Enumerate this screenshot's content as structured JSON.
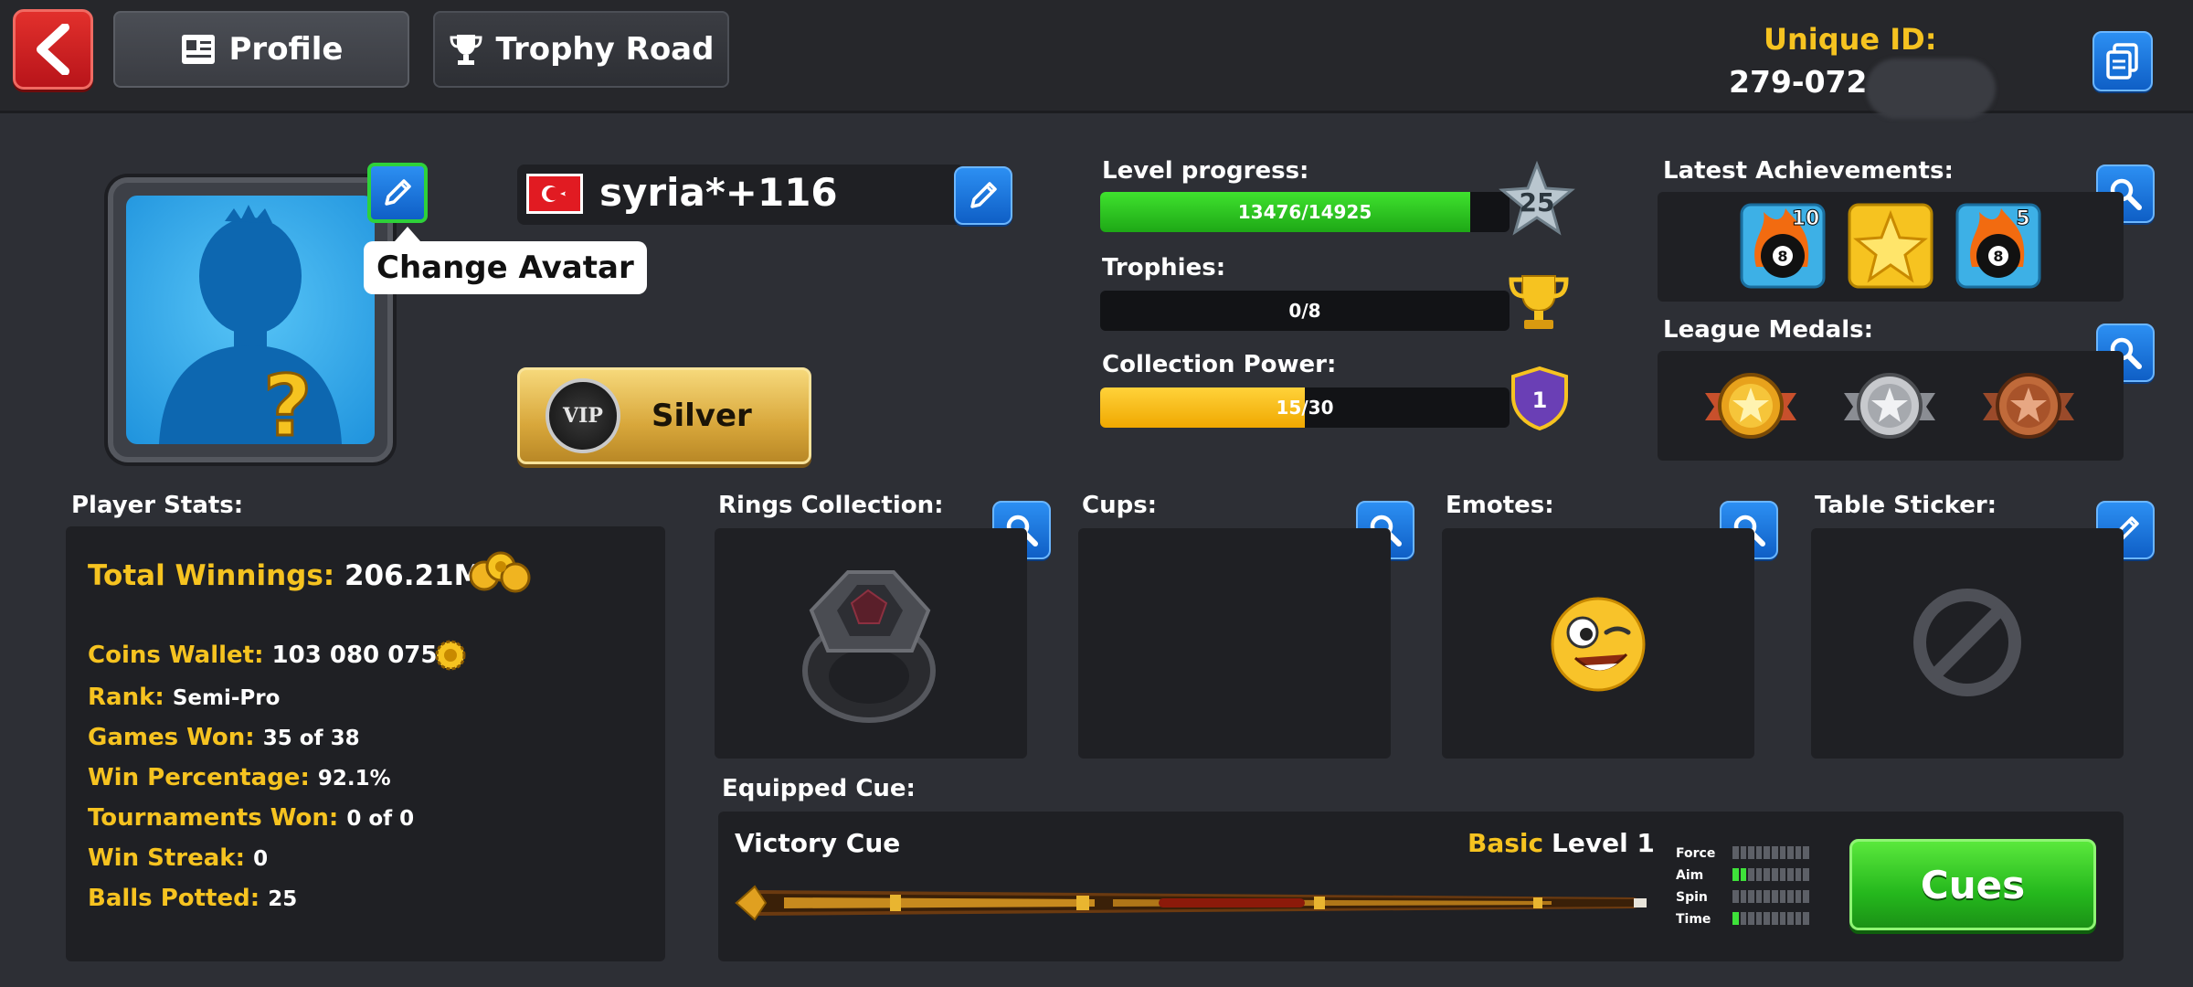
{
  "header": {
    "profile_tab": "Profile",
    "trophy_road_tab": "Trophy Road",
    "unique_id_label": "Unique ID:",
    "unique_id_value": "279-072"
  },
  "avatar": {
    "tooltip": "Change Avatar"
  },
  "player": {
    "name": "syria*+116",
    "vip_tier": "Silver",
    "vip_badge": "VIP"
  },
  "progress": {
    "level_label": "Level progress:",
    "level_text": "13476/14925",
    "level_fraction": 0.903,
    "level_number": "25",
    "trophies_label": "Trophies:",
    "trophies_text": "0/8",
    "trophies_fraction": 0.0,
    "collection_label": "Collection Power:",
    "collection_text": "15/30",
    "collection_fraction": 0.5,
    "collection_badge": "1"
  },
  "achievements": {
    "label": "Latest Achievements:",
    "items": [
      {
        "icon": "eight-ball-fire-icon",
        "count": "10"
      },
      {
        "icon": "gold-star-icon",
        "count": ""
      },
      {
        "icon": "eight-ball-fire-icon",
        "count": "5"
      }
    ]
  },
  "league_medals": {
    "label": "League Medals:",
    "items": [
      "gold-medal-icon",
      "silver-medal-icon",
      "bronze-medal-icon"
    ]
  },
  "stats": {
    "title": "Player Stats:",
    "total_winnings_label": "Total Winnings:",
    "total_winnings_value": "206.21M",
    "coins_wallet_label": "Coins Wallet:",
    "coins_wallet_value": "103 080 075",
    "rank_label": "Rank:",
    "rank_value": "Semi-Pro",
    "games_won_label": "Games Won:",
    "games_won_value": "35 of 38",
    "win_percentage_label": "Win Percentage:",
    "win_percentage_value": "92.1%",
    "tournaments_won_label": "Tournaments Won:",
    "tournaments_won_value": "0 of 0",
    "win_streak_label": "Win Streak:",
    "win_streak_value": "0",
    "balls_potted_label": "Balls Potted:",
    "balls_potted_value": "25"
  },
  "sections": {
    "rings": "Rings Collection:",
    "cups": "Cups:",
    "emotes": "Emotes:",
    "table_sticker": "Table Sticker:"
  },
  "cue": {
    "section_label": "Equipped Cue:",
    "name": "Victory Cue",
    "rarity": "Basic",
    "level": "Level 1",
    "stat_labels": [
      "Force",
      "Aim",
      "Spin",
      "Time"
    ],
    "stat_levels": [
      0,
      2,
      0,
      1
    ],
    "stat_max": 10,
    "cues_button": "Cues"
  },
  "colors": {
    "accent_yellow": "#f6c320",
    "level_green": "#27c51b",
    "collection_yellow": "#f5b800",
    "button_blue": "#1878e0",
    "background": "#2d2f35"
  }
}
